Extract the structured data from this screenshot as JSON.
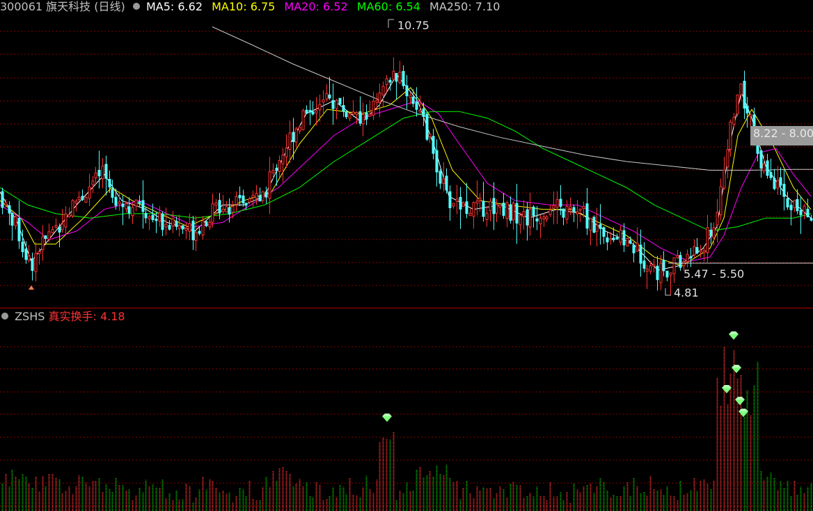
{
  "header": {
    "code": "300061",
    "name": "旗天科技",
    "period": "(日线)",
    "ma_items": [
      {
        "label": "MA5: ",
        "value": "6.62",
        "color": "#ffffff"
      },
      {
        "label": "MA10: ",
        "value": "6.75",
        "color": "#ffff00"
      },
      {
        "label": "MA20: ",
        "value": "6.52",
        "color": "#ff00ff"
      },
      {
        "label": "MA60: ",
        "value": "6.54",
        "color": "#00ff00"
      },
      {
        "label": "MA250: ",
        "value": "7.10",
        "color": "#c8c8c8"
      }
    ]
  },
  "indicator": {
    "name": "ZSHS",
    "label": "真实换手: ",
    "value": "4.18",
    "name_color": "#c0c0c0",
    "label_color": "#ff3333"
  },
  "annotations": {
    "high": "10.75",
    "low": "4.81",
    "range_upper": "8.22 - 8.00",
    "range_lower": "5.47 - 5.50"
  },
  "colors": {
    "up": "#ff3232",
    "down": "#54ffff",
    "grid": "#8b0000",
    "vol_up": "#ff3232",
    "vol_down": "#00c000",
    "marker": "#7dff7d"
  },
  "chart_data": {
    "type": "candlestick",
    "price_range": [
      4.6,
      11.2
    ],
    "series": [
      {
        "name": "MA5",
        "color": "#ffffff",
        "values": [
          [
            0,
            7.2
          ],
          [
            25,
            6.5
          ],
          [
            45,
            5.6
          ],
          [
            70,
            6.1
          ],
          [
            110,
            6.9
          ],
          [
            150,
            7.6
          ],
          [
            175,
            7.0
          ],
          [
            210,
            6.8
          ],
          [
            240,
            6.5
          ],
          [
            280,
            6.3
          ],
          [
            320,
            6.9
          ],
          [
            350,
            6.9
          ],
          [
            380,
            7.1
          ],
          [
            410,
            8.1
          ],
          [
            440,
            9.0
          ],
          [
            480,
            9.3
          ],
          [
            520,
            8.8
          ],
          [
            545,
            9.2
          ],
          [
            570,
            9.9
          ],
          [
            600,
            9.3
          ],
          [
            625,
            8.2
          ],
          [
            645,
            7.1
          ],
          [
            680,
            6.8
          ],
          [
            720,
            6.9
          ],
          [
            760,
            6.6
          ],
          [
            800,
            6.8
          ],
          [
            835,
            6.7
          ],
          [
            870,
            6.3
          ],
          [
            910,
            6.0
          ],
          [
            945,
            5.4
          ],
          [
            975,
            5.5
          ],
          [
            1010,
            5.9
          ],
          [
            1030,
            6.4
          ],
          [
            1050,
            8.4
          ],
          [
            1065,
            9.5
          ],
          [
            1080,
            8.9
          ],
          [
            1100,
            7.8
          ],
          [
            1130,
            7.1
          ],
          [
            1165,
            6.6
          ]
        ]
      },
      {
        "name": "MA10",
        "color": "#ffff00",
        "values": [
          [
            0,
            7.0
          ],
          [
            30,
            6.6
          ],
          [
            50,
            6.0
          ],
          [
            80,
            6.0
          ],
          [
            120,
            6.6
          ],
          [
            160,
            7.3
          ],
          [
            190,
            7.0
          ],
          [
            230,
            6.7
          ],
          [
            270,
            6.4
          ],
          [
            310,
            6.7
          ],
          [
            350,
            7.0
          ],
          [
            390,
            7.2
          ],
          [
            430,
            8.3
          ],
          [
            470,
            9.1
          ],
          [
            520,
            9.0
          ],
          [
            560,
            9.2
          ],
          [
            590,
            9.6
          ],
          [
            620,
            8.9
          ],
          [
            650,
            7.7
          ],
          [
            690,
            7.0
          ],
          [
            730,
            6.9
          ],
          [
            780,
            6.8
          ],
          [
            820,
            6.8
          ],
          [
            860,
            6.5
          ],
          [
            900,
            6.2
          ],
          [
            940,
            5.7
          ],
          [
            980,
            5.5
          ],
          [
            1020,
            5.9
          ],
          [
            1040,
            6.6
          ],
          [
            1060,
            8.5
          ],
          [
            1080,
            9.1
          ],
          [
            1110,
            8.3
          ],
          [
            1140,
            7.3
          ],
          [
            1165,
            6.8
          ]
        ]
      },
      {
        "name": "MA20",
        "color": "#ff00ff",
        "values": [
          [
            0,
            6.9
          ],
          [
            40,
            6.5
          ],
          [
            70,
            6.1
          ],
          [
            110,
            6.3
          ],
          [
            150,
            6.8
          ],
          [
            200,
            7.0
          ],
          [
            240,
            6.7
          ],
          [
            280,
            6.4
          ],
          [
            320,
            6.5
          ],
          [
            360,
            6.9
          ],
          [
            400,
            7.3
          ],
          [
            440,
            7.9
          ],
          [
            480,
            8.5
          ],
          [
            520,
            8.9
          ],
          [
            560,
            9.1
          ],
          [
            600,
            9.3
          ],
          [
            630,
            9.0
          ],
          [
            660,
            8.3
          ],
          [
            700,
            7.4
          ],
          [
            740,
            7.0
          ],
          [
            790,
            6.9
          ],
          [
            830,
            6.9
          ],
          [
            870,
            6.6
          ],
          [
            910,
            6.3
          ],
          [
            950,
            5.9
          ],
          [
            990,
            5.6
          ],
          [
            1020,
            5.7
          ],
          [
            1040,
            6.2
          ],
          [
            1065,
            7.3
          ],
          [
            1090,
            8.1
          ],
          [
            1115,
            8.2
          ],
          [
            1140,
            7.6
          ],
          [
            1165,
            7.1
          ]
        ]
      },
      {
        "name": "MA60",
        "color": "#00ff00",
        "values": [
          [
            0,
            7.3
          ],
          [
            40,
            6.9
          ],
          [
            80,
            6.7
          ],
          [
            130,
            6.6
          ],
          [
            180,
            6.7
          ],
          [
            230,
            6.7
          ],
          [
            280,
            6.6
          ],
          [
            330,
            6.7
          ],
          [
            380,
            6.9
          ],
          [
            430,
            7.3
          ],
          [
            480,
            7.9
          ],
          [
            530,
            8.4
          ],
          [
            580,
            8.9
          ],
          [
            620,
            9.05
          ],
          [
            660,
            9.05
          ],
          [
            700,
            8.9
          ],
          [
            740,
            8.6
          ],
          [
            780,
            8.2
          ],
          [
            820,
            7.9
          ],
          [
            860,
            7.6
          ],
          [
            900,
            7.3
          ],
          [
            940,
            6.9
          ],
          [
            980,
            6.6
          ],
          [
            1020,
            6.3
          ],
          [
            1060,
            6.4
          ],
          [
            1100,
            6.6
          ],
          [
            1140,
            6.6
          ],
          [
            1165,
            6.7
          ]
        ]
      },
      {
        "name": "MA250",
        "color": "#c8c8c8",
        "values": [
          [
            305,
            11.0
          ],
          [
            360,
            10.6
          ],
          [
            420,
            10.15
          ],
          [
            480,
            9.75
          ],
          [
            540,
            9.35
          ],
          [
            600,
            9.0
          ],
          [
            660,
            8.7
          ],
          [
            720,
            8.45
          ],
          [
            780,
            8.25
          ],
          [
            840,
            8.05
          ],
          [
            900,
            7.9
          ],
          [
            960,
            7.8
          ],
          [
            1020,
            7.7
          ],
          [
            1080,
            7.7
          ],
          [
            1140,
            7.72
          ],
          [
            1168,
            7.72
          ]
        ]
      }
    ]
  }
}
